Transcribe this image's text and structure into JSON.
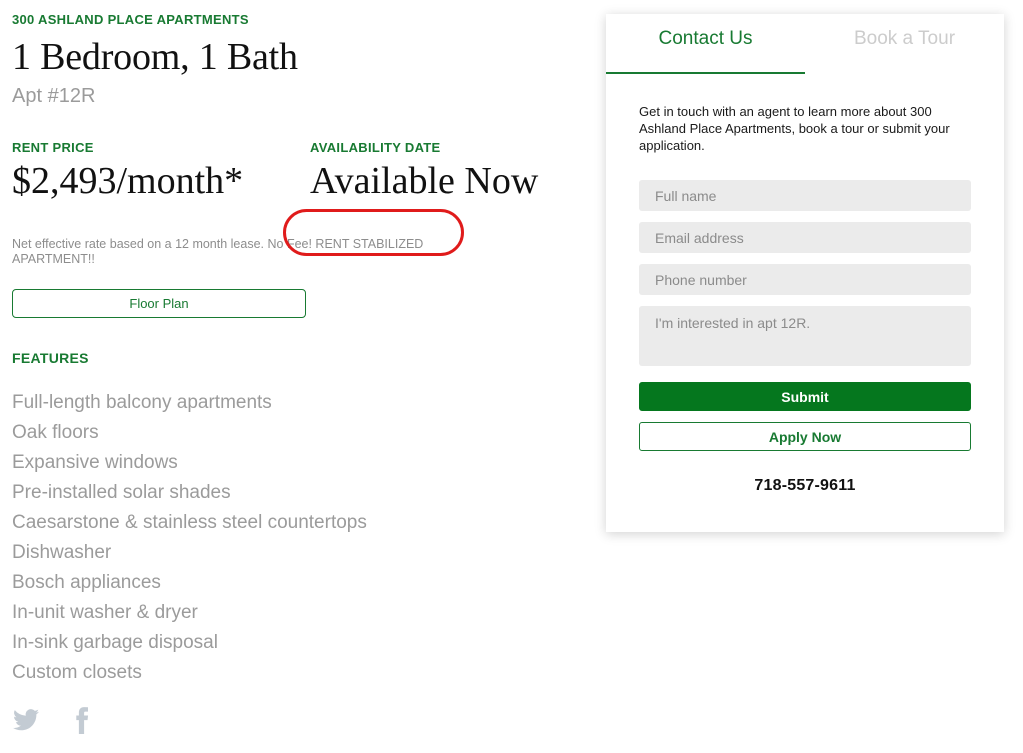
{
  "listing": {
    "property_name": "300 ASHLAND PLACE APARTMENTS",
    "unit_title": "1 Bedroom, 1 Bath",
    "unit_number": "Apt #12R",
    "rent_label": "RENT PRICE",
    "rent_value": "$2,493/month*",
    "availability_label": "AVAILABILITY DATE",
    "availability_value": "Available Now",
    "disclaimer": "Net effective rate based on a 12 month lease. No Fee! RENT STABILIZED APARTMENT!!",
    "floor_plan_label": "Floor Plan",
    "features_label": "FEATURES",
    "features": [
      "Full-length balcony apartments",
      "Oak floors",
      "Expansive windows",
      "Pre-installed solar shades",
      "Caesarstone & stainless steel countertops",
      "Dishwasher",
      "Bosch appliances",
      "In-unit washer & dryer",
      "In-sink garbage disposal",
      "Custom closets"
    ]
  },
  "annotation": {
    "shape": "ellipse",
    "color": "#e01b1b",
    "highlighted_text": "No Fee! RENT STABILIZED"
  },
  "social": [
    {
      "icon": "twitter-icon"
    },
    {
      "icon": "facebook-icon"
    }
  ],
  "contact_card": {
    "tabs": [
      {
        "label": "Contact Us",
        "active": true
      },
      {
        "label": "Book a Tour",
        "active": false
      }
    ],
    "description": "Get in touch with an agent to learn more about 300 Ashland Place Apartments, book a tour or submit your application.",
    "fields": [
      {
        "name": "full-name",
        "placeholder": "Full name",
        "value": ""
      },
      {
        "name": "email",
        "placeholder": "Email address",
        "value": ""
      },
      {
        "name": "phone",
        "placeholder": "Phone number",
        "value": ""
      },
      {
        "name": "message",
        "placeholder": "I'm interested in apt 12R.",
        "value": ""
      }
    ],
    "submit_label": "Submit",
    "apply_label": "Apply Now",
    "phone": "718-557-9611"
  },
  "colors": {
    "brand_green": "#187a32",
    "submit_green": "#05771e",
    "annotation_red": "#e01b1b",
    "muted_text": "#9b9b9b",
    "field_bg": "#ebebeb"
  }
}
